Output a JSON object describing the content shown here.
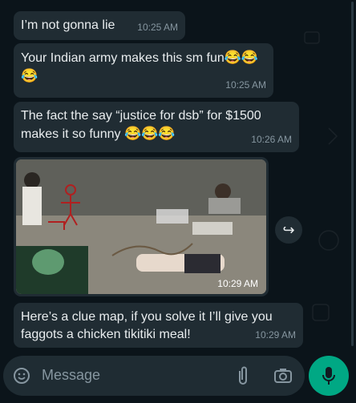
{
  "messages": [
    {
      "text": "I’m not gonna lie",
      "time": "10:25 AM"
    },
    {
      "text": "Your Indian army makes this sm fun",
      "emoji": "😂😂",
      "line2": "😂",
      "time": "10:25 AM"
    },
    {
      "text": "The fact the say “justice for dsb” for $1500",
      "line2": "makes it so funny",
      "emoji": "😂😂😂",
      "time": "10:26 AM"
    },
    {
      "type": "image",
      "time": "10:29 AM"
    },
    {
      "text": "Here’s a clue map, if you solve it I’ll give you",
      "line2": "faggots a chicken tikitiki meal!",
      "time": "10:29 AM"
    }
  ],
  "composer": {
    "placeholder": "Message"
  },
  "icons": {
    "emoji": "emoji-sticker-icon",
    "attach": "paperclip-icon",
    "camera": "camera-icon",
    "mic": "microphone-icon",
    "forward": "forward-icon"
  },
  "colors": {
    "background": "#0b141a",
    "bubble": "#202c33",
    "accent": "#00a884",
    "meta": "#8696a0"
  }
}
